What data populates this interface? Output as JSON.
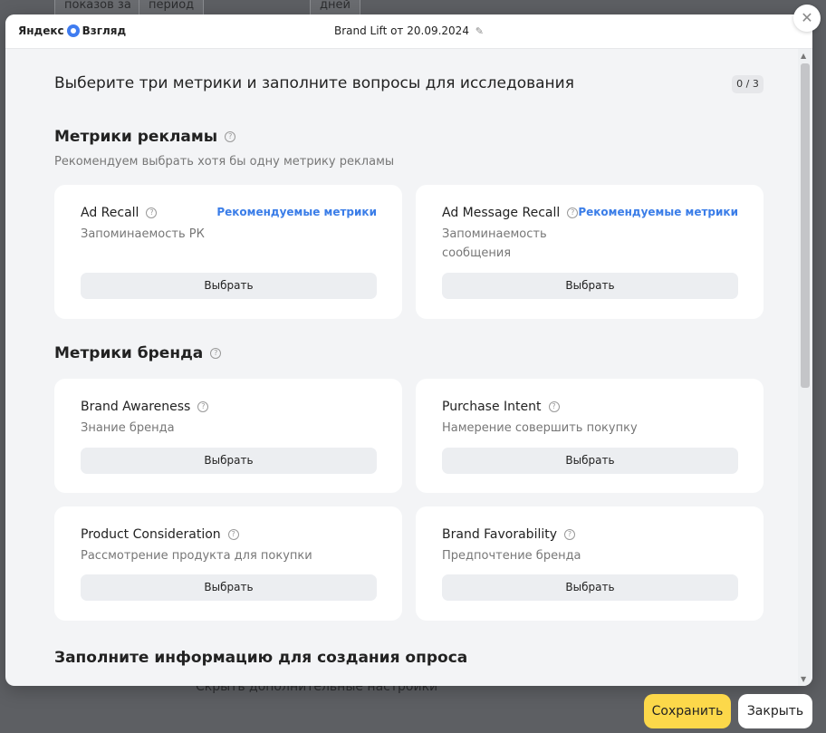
{
  "background": {
    "top_cells": [
      "показов за",
      "период",
      "дней"
    ],
    "bottom_text": "Скрыть дополнительные настройки"
  },
  "header": {
    "logo_prefix": "Яндекс",
    "logo_name": "Взгляд",
    "title": "Brand Lift от 20.09.2024"
  },
  "main": {
    "title": "Выберите три метрики и заполните вопросы для исследования",
    "counter": "0 / 3",
    "ad_section": {
      "title": "Метрики рекламы",
      "subtitle": "Рекомендуем выбрать хотя бы одну метрику рекламы",
      "cards": [
        {
          "title": "Ad Recall",
          "desc": "Запоминаемость РК",
          "link": "Рекомендуемые метрики",
          "button": "Выбрать"
        },
        {
          "title": "Ad Message Recall",
          "desc_line1": "Запоминаемость",
          "desc_line2": "сообщения",
          "link": "Рекомендуемые метрики",
          "button": "Выбрать"
        }
      ]
    },
    "brand_section": {
      "title": "Метрики бренда",
      "cards": [
        {
          "title": "Brand Awareness",
          "desc": "Знание бренда",
          "button": "Выбрать"
        },
        {
          "title": "Purchase Intent",
          "desc": "Намерение совершить покупку",
          "button": "Выбрать"
        },
        {
          "title": "Product Consideration",
          "desc": "Рассмотрение продукта для покупки",
          "button": "Выбрать"
        },
        {
          "title": "Brand Favorability",
          "desc": "Предпочтение бренда",
          "button": "Выбрать"
        }
      ]
    },
    "fill_title": "Заполните информацию для создания опроса"
  },
  "footer": {
    "save": "Сохранить",
    "close": "Закрыть"
  },
  "colors": {
    "accent_yellow": "#fcd84a",
    "link_blue": "#3a7de8",
    "logo_blue": "#3f7cf0"
  }
}
